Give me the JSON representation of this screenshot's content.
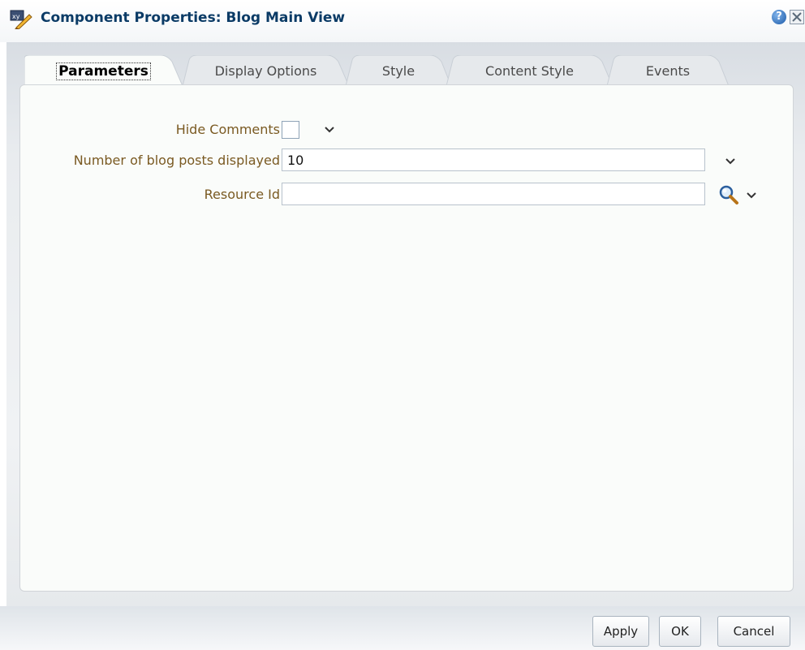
{
  "dialog": {
    "title": "Component Properties: Blog Main View",
    "title_icon": "component-properties-icon",
    "help_glyph": "?",
    "help_icon": "help-icon",
    "close_icon": "close-icon"
  },
  "tabs": [
    {
      "label": "Parameters",
      "active": true
    },
    {
      "label": "Display Options",
      "active": false
    },
    {
      "label": "Style",
      "active": false
    },
    {
      "label": "Content Style",
      "active": false
    },
    {
      "label": "Events",
      "active": false
    }
  ],
  "form": {
    "hide_comments": {
      "label": "Hide Comments",
      "checked": false,
      "icon": "chevron-down-icon"
    },
    "posts_displayed": {
      "label": "Number of blog posts displayed",
      "value": "10",
      "icon": "chevron-down-icon"
    },
    "resource_id": {
      "label": "Resource Id",
      "value": "",
      "search_icon": "search-icon",
      "icon": "chevron-down-icon"
    }
  },
  "buttons": {
    "apply": "Apply",
    "ok": "OK",
    "cancel": "Cancel"
  },
  "colors": {
    "title": "#0b3b66",
    "label": "#7a5a22",
    "panel": "#fafcfa",
    "tab_inactive": "#e9ecef"
  }
}
